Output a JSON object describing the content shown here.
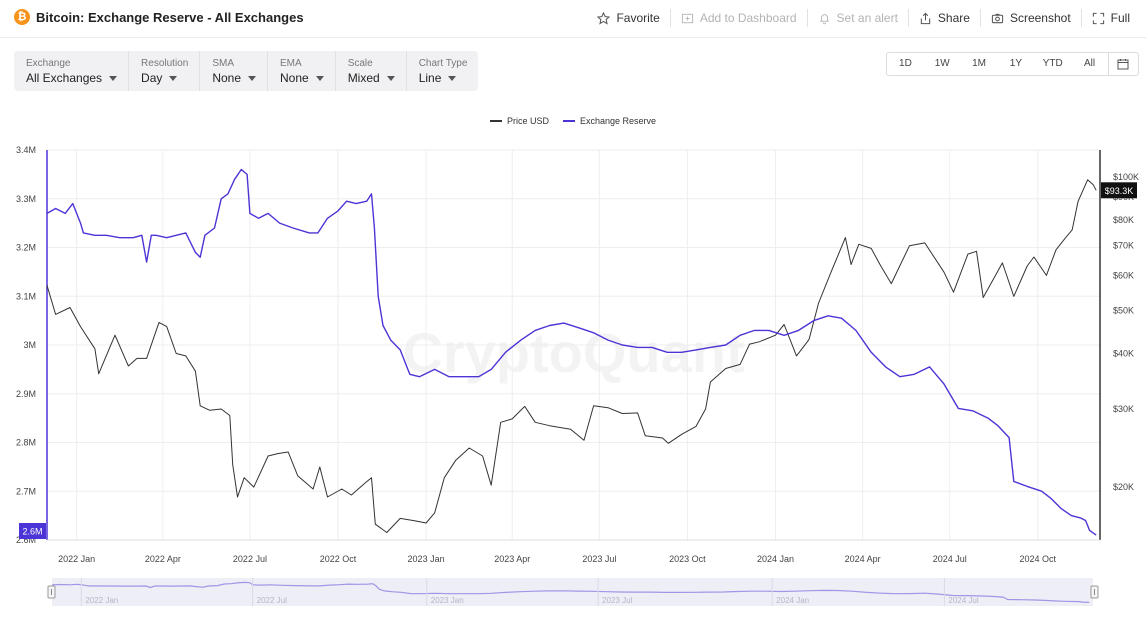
{
  "header": {
    "coin_icon": "bitcoin-icon",
    "title": "Bitcoin: Exchange Reserve - All Exchanges",
    "actions": [
      {
        "label": "Favorite",
        "icon": "star-icon",
        "enabled": true
      },
      {
        "label": "Add to Dashboard",
        "icon": "dashboard-add-icon",
        "enabled": false
      },
      {
        "label": "Set an alert",
        "icon": "bell-icon",
        "enabled": false
      },
      {
        "label": "Share",
        "icon": "share-icon",
        "enabled": true
      },
      {
        "label": "Screenshot",
        "icon": "camera-icon",
        "enabled": true
      },
      {
        "label": "Full",
        "icon": "fullscreen-icon",
        "enabled": true
      }
    ]
  },
  "controls": [
    {
      "label": "Exchange",
      "value": "All Exchanges"
    },
    {
      "label": "Resolution",
      "value": "Day"
    },
    {
      "label": "SMA",
      "value": "None"
    },
    {
      "label": "EMA",
      "value": "None"
    },
    {
      "label": "Scale",
      "value": "Mixed"
    },
    {
      "label": "Chart Type",
      "value": "Line"
    }
  ],
  "ranges": [
    "1D",
    "1W",
    "1M",
    "1Y",
    "YTD",
    "All"
  ],
  "watermark": "CryptoQuant",
  "colors": {
    "price": "#333333",
    "reserve": "#4b35d6",
    "reserve_navigator": "#9f96e6",
    "badge_price_bg": "#111111",
    "grid": "#eeeeee"
  },
  "chart_data": {
    "type": "line",
    "legend": [
      "Price USD",
      "Exchange Reserve"
    ],
    "legend_position": "top-center",
    "grid": true,
    "x_ticks": [
      "2022 Jan",
      "2022 Apr",
      "2022 Jul",
      "2022 Oct",
      "2023 Jan",
      "2023 Apr",
      "2023 Jul",
      "2023 Oct",
      "2024 Jan",
      "2024 Apr",
      "2024 Jul",
      "2024 Oct"
    ],
    "x_range": [
      "2021-12-01",
      "2024-12-05"
    ],
    "left_axis": {
      "ticks": [
        "3.4M",
        "3.3M",
        "3.2M",
        "3.1M",
        "3M",
        "2.9M",
        "2.8M",
        "2.7M",
        "2.6M"
      ],
      "range": [
        2.6,
        3.4
      ],
      "unit": "M"
    },
    "right_axis": {
      "scale": "log",
      "ticks": [
        {
          "label": "$100K",
          "value": 100000
        },
        {
          "label": "$90K",
          "value": 90000
        },
        {
          "label": "$80K",
          "value": 80000
        },
        {
          "label": "$70K",
          "value": 70000
        },
        {
          "label": "$60K",
          "value": 60000
        },
        {
          "label": "$50K",
          "value": 50000
        },
        {
          "label": "$40K",
          "value": 40000
        },
        {
          "label": "$30K",
          "value": 30000
        },
        {
          "label": "$20K",
          "value": 20000
        }
      ],
      "range": [
        15200,
        115000
      ]
    },
    "current_reserve_label": "2.6M",
    "current_price_label": "$93.3K",
    "navigator_ticks": [
      "2022 Jan",
      "2022 Jul",
      "2023 Jan",
      "2023 Jul",
      "2024 Jan",
      "2024 Jul"
    ],
    "series": [
      {
        "name": "Price USD",
        "axis": "right",
        "points": [
          [
            "2021-12-01",
            57000
          ],
          [
            "2021-12-10",
            49000
          ],
          [
            "2021-12-25",
            50800
          ],
          [
            "2022-01-05",
            46000
          ],
          [
            "2022-01-20",
            41000
          ],
          [
            "2022-01-24",
            36000
          ],
          [
            "2022-02-05",
            41500
          ],
          [
            "2022-02-10",
            44000
          ],
          [
            "2022-02-24",
            37500
          ],
          [
            "2022-03-05",
            39000
          ],
          [
            "2022-03-15",
            39000
          ],
          [
            "2022-03-28",
            47000
          ],
          [
            "2022-04-05",
            46000
          ],
          [
            "2022-04-15",
            40000
          ],
          [
            "2022-04-25",
            39500
          ],
          [
            "2022-05-05",
            36500
          ],
          [
            "2022-05-10",
            30500
          ],
          [
            "2022-05-20",
            29800
          ],
          [
            "2022-06-01",
            30000
          ],
          [
            "2022-06-10",
            29000
          ],
          [
            "2022-06-13",
            22500
          ],
          [
            "2022-06-18",
            19000
          ],
          [
            "2022-06-25",
            21000
          ],
          [
            "2022-07-05",
            20000
          ],
          [
            "2022-07-20",
            23500
          ],
          [
            "2022-07-30",
            23800
          ],
          [
            "2022-08-10",
            24000
          ],
          [
            "2022-08-20",
            21200
          ],
          [
            "2022-09-05",
            19800
          ],
          [
            "2022-09-12",
            22200
          ],
          [
            "2022-09-20",
            19000
          ],
          [
            "2022-10-05",
            19800
          ],
          [
            "2022-10-15",
            19200
          ],
          [
            "2022-10-30",
            20500
          ],
          [
            "2022-11-05",
            21000
          ],
          [
            "2022-11-09",
            16500
          ],
          [
            "2022-11-21",
            15800
          ],
          [
            "2022-12-05",
            17000
          ],
          [
            "2022-12-20",
            16800
          ],
          [
            "2023-01-01",
            16600
          ],
          [
            "2023-01-10",
            17500
          ],
          [
            "2023-01-20",
            21000
          ],
          [
            "2023-02-01",
            23000
          ],
          [
            "2023-02-15",
            24500
          ],
          [
            "2023-03-01",
            23500
          ],
          [
            "2023-03-10",
            20200
          ],
          [
            "2023-03-20",
            28000
          ],
          [
            "2023-04-01",
            28500
          ],
          [
            "2023-04-14",
            30400
          ],
          [
            "2023-04-25",
            28000
          ],
          [
            "2023-05-10",
            27500
          ],
          [
            "2023-06-01",
            27000
          ],
          [
            "2023-06-15",
            25500
          ],
          [
            "2023-06-25",
            30500
          ],
          [
            "2023-07-10",
            30200
          ],
          [
            "2023-07-25",
            29300
          ],
          [
            "2023-08-10",
            29400
          ],
          [
            "2023-08-18",
            26100
          ],
          [
            "2023-09-05",
            25800
          ],
          [
            "2023-09-11",
            25100
          ],
          [
            "2023-09-25",
            26300
          ],
          [
            "2023-10-10",
            27400
          ],
          [
            "2023-10-20",
            30000
          ],
          [
            "2023-10-25",
            34500
          ],
          [
            "2023-11-10",
            37000
          ],
          [
            "2023-11-25",
            37800
          ],
          [
            "2023-12-05",
            42000
          ],
          [
            "2023-12-15",
            42500
          ],
          [
            "2024-01-01",
            44000
          ],
          [
            "2024-01-10",
            46500
          ],
          [
            "2024-01-23",
            39500
          ],
          [
            "2024-02-05",
            43000
          ],
          [
            "2024-02-15",
            52000
          ],
          [
            "2024-02-28",
            61000
          ],
          [
            "2024-03-14",
            73000
          ],
          [
            "2024-03-20",
            63500
          ],
          [
            "2024-03-28",
            70500
          ],
          [
            "2024-04-10",
            69000
          ],
          [
            "2024-04-20",
            63000
          ],
          [
            "2024-05-01",
            57500
          ],
          [
            "2024-05-20",
            70000
          ],
          [
            "2024-06-05",
            71000
          ],
          [
            "2024-06-25",
            61000
          ],
          [
            "2024-07-05",
            55000
          ],
          [
            "2024-07-20",
            67000
          ],
          [
            "2024-07-29",
            68000
          ],
          [
            "2024-08-05",
            53500
          ],
          [
            "2024-08-25",
            64000
          ],
          [
            "2024-09-06",
            53800
          ],
          [
            "2024-09-20",
            63000
          ],
          [
            "2024-09-27",
            66000
          ],
          [
            "2024-10-10",
            60000
          ],
          [
            "2024-10-20",
            68500
          ],
          [
            "2024-10-29",
            72500
          ],
          [
            "2024-11-06",
            76000
          ],
          [
            "2024-11-12",
            88000
          ],
          [
            "2024-11-22",
            98500
          ],
          [
            "2024-11-28",
            96000
          ],
          [
            "2024-12-01",
            93300
          ]
        ]
      },
      {
        "name": "Exchange Reserve",
        "axis": "left",
        "unit": "M",
        "points": [
          [
            "2021-12-01",
            3.27
          ],
          [
            "2021-12-10",
            3.28
          ],
          [
            "2021-12-20",
            3.27
          ],
          [
            "2021-12-28",
            3.29
          ],
          [
            "2022-01-05",
            3.25
          ],
          [
            "2022-01-08",
            3.23
          ],
          [
            "2022-01-20",
            3.225
          ],
          [
            "2022-02-01",
            3.225
          ],
          [
            "2022-02-15",
            3.22
          ],
          [
            "2022-03-01",
            3.22
          ],
          [
            "2022-03-10",
            3.225
          ],
          [
            "2022-03-15",
            3.17
          ],
          [
            "2022-03-20",
            3.225
          ],
          [
            "2022-03-25",
            3.225
          ],
          [
            "2022-04-05",
            3.22
          ],
          [
            "2022-04-15",
            3.225
          ],
          [
            "2022-04-25",
            3.23
          ],
          [
            "2022-05-05",
            3.19
          ],
          [
            "2022-05-10",
            3.18
          ],
          [
            "2022-05-15",
            3.225
          ],
          [
            "2022-05-25",
            3.24
          ],
          [
            "2022-06-01",
            3.3
          ],
          [
            "2022-06-08",
            3.31
          ],
          [
            "2022-06-15",
            3.34
          ],
          [
            "2022-06-22",
            3.36
          ],
          [
            "2022-06-28",
            3.35
          ],
          [
            "2022-07-01",
            3.27
          ],
          [
            "2022-07-10",
            3.26
          ],
          [
            "2022-07-20",
            3.27
          ],
          [
            "2022-08-01",
            3.25
          ],
          [
            "2022-08-15",
            3.24
          ],
          [
            "2022-09-01",
            3.23
          ],
          [
            "2022-09-10",
            3.23
          ],
          [
            "2022-09-20",
            3.26
          ],
          [
            "2022-10-01",
            3.275
          ],
          [
            "2022-10-10",
            3.295
          ],
          [
            "2022-10-20",
            3.29
          ],
          [
            "2022-10-31",
            3.295
          ],
          [
            "2022-11-05",
            3.31
          ],
          [
            "2022-11-08",
            3.24
          ],
          [
            "2022-11-12",
            3.1
          ],
          [
            "2022-11-17",
            3.04
          ],
          [
            "2022-11-25",
            3.01
          ],
          [
            "2022-12-05",
            2.99
          ],
          [
            "2022-12-15",
            2.94
          ],
          [
            "2022-12-25",
            2.935
          ],
          [
            "2023-01-10",
            2.95
          ],
          [
            "2023-01-25",
            2.935
          ],
          [
            "2023-02-10",
            2.935
          ],
          [
            "2023-02-25",
            2.935
          ],
          [
            "2023-03-10",
            2.95
          ],
          [
            "2023-03-25",
            2.985
          ],
          [
            "2023-04-10",
            3.01
          ],
          [
            "2023-04-25",
            3.03
          ],
          [
            "2023-05-10",
            3.04
          ],
          [
            "2023-05-25",
            3.045
          ],
          [
            "2023-06-10",
            3.035
          ],
          [
            "2023-06-25",
            3.025
          ],
          [
            "2023-07-10",
            3.01
          ],
          [
            "2023-07-25",
            3.0
          ],
          [
            "2023-08-10",
            2.995
          ],
          [
            "2023-08-25",
            2.995
          ],
          [
            "2023-09-10",
            2.985
          ],
          [
            "2023-09-25",
            2.985
          ],
          [
            "2023-10-10",
            2.99
          ],
          [
            "2023-10-25",
            2.995
          ],
          [
            "2023-11-10",
            3.0
          ],
          [
            "2023-11-25",
            3.02
          ],
          [
            "2023-12-10",
            3.03
          ],
          [
            "2023-12-25",
            3.03
          ],
          [
            "2024-01-10",
            3.02
          ],
          [
            "2024-01-25",
            3.03
          ],
          [
            "2024-02-10",
            3.05
          ],
          [
            "2024-02-25",
            3.06
          ],
          [
            "2024-03-10",
            3.055
          ],
          [
            "2024-03-25",
            3.03
          ],
          [
            "2024-04-10",
            2.985
          ],
          [
            "2024-04-25",
            2.955
          ],
          [
            "2024-05-10",
            2.935
          ],
          [
            "2024-05-25",
            2.94
          ],
          [
            "2024-06-10",
            2.955
          ],
          [
            "2024-06-25",
            2.92
          ],
          [
            "2024-07-10",
            2.87
          ],
          [
            "2024-07-25",
            2.865
          ],
          [
            "2024-08-10",
            2.85
          ],
          [
            "2024-08-20",
            2.835
          ],
          [
            "2024-09-01",
            2.81
          ],
          [
            "2024-09-06",
            2.72
          ],
          [
            "2024-09-20",
            2.71
          ],
          [
            "2024-10-05",
            2.7
          ],
          [
            "2024-10-15",
            2.685
          ],
          [
            "2024-10-25",
            2.665
          ],
          [
            "2024-11-05",
            2.65
          ],
          [
            "2024-11-15",
            2.645
          ],
          [
            "2024-11-20",
            2.64
          ],
          [
            "2024-11-24",
            2.62
          ],
          [
            "2024-12-01",
            2.61
          ]
        ]
      }
    ]
  }
}
